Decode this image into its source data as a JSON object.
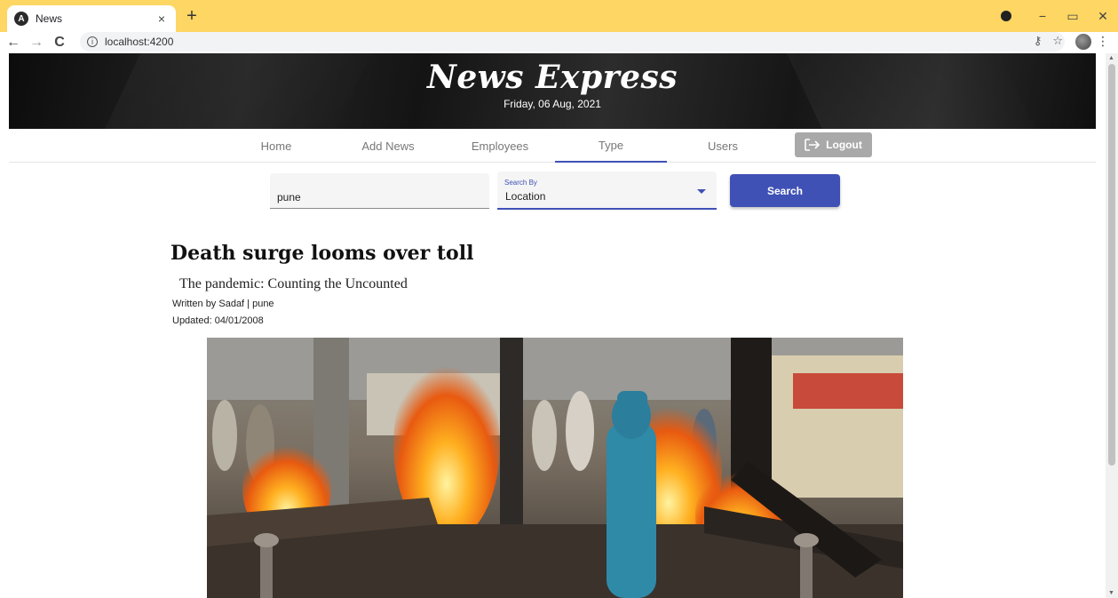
{
  "browser": {
    "tab_title": "News",
    "url": "localhost:4200",
    "tab_close": "×",
    "new_tab": "+"
  },
  "site": {
    "title": "News Express",
    "date": "Friday, 06 Aug, 2021"
  },
  "nav": {
    "items": [
      "Home",
      "Add News",
      "Employees",
      "Type",
      "Users"
    ],
    "active": "Type",
    "logout_label": "Logout"
  },
  "search": {
    "value": "pune",
    "select_label": "Search By",
    "select_value": "Location",
    "button_label": "Search"
  },
  "article": {
    "title": "Death surge looms over toll",
    "subtitle": "The pandemic: Counting the Uncounted",
    "byline": "Written by Sadaf | pune",
    "updated": "Updated: 04/01/2008"
  },
  "colors": {
    "tabstrip": "#fdd663",
    "primary": "#3f51b5",
    "logout": "#a9a9a9"
  },
  "icons": {
    "back": "arrow-left-icon",
    "forward": "arrow-right-icon",
    "reload": "reload-icon",
    "info": "info-icon",
    "key": "key-icon",
    "star": "star-icon",
    "logout": "logout-icon"
  }
}
